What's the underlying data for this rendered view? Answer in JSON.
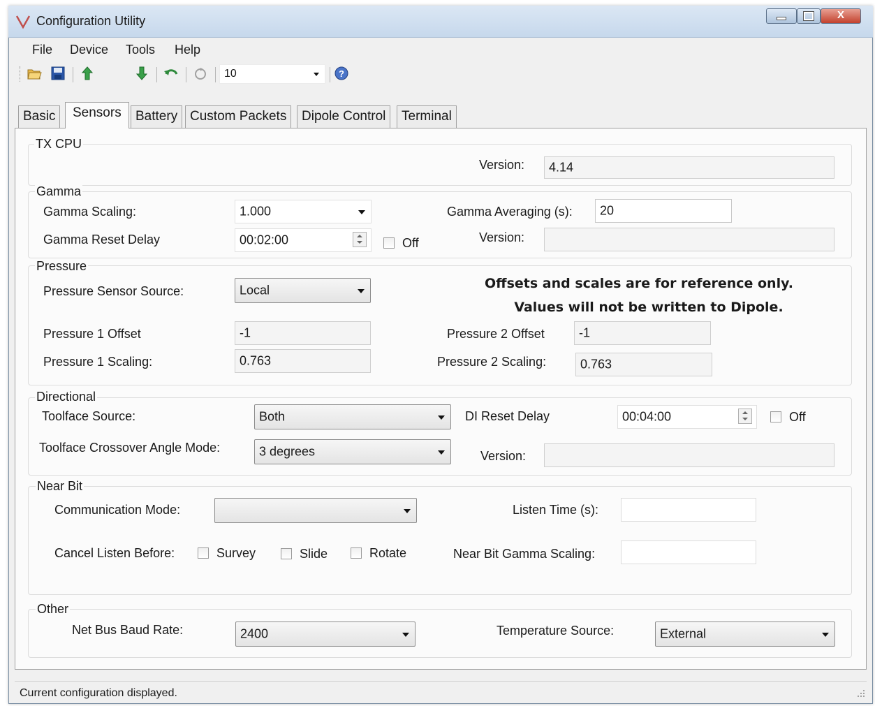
{
  "window": {
    "title": "Configuration Utility"
  },
  "menu": [
    "File",
    "Device",
    "Tools",
    "Help"
  ],
  "toolbar": {
    "combo_value": "10",
    "icons": [
      "open-folder-icon",
      "save-icon",
      "upload-icon",
      "download-icon",
      "undo-icon",
      "refresh-icon",
      "help-icon"
    ]
  },
  "tabs": [
    "Basic",
    "Sensors",
    "Battery",
    "Custom Packets",
    "Dipole Control",
    "Terminal"
  ],
  "active_tab": "Sensors",
  "tx_cpu": {
    "group_label": "TX CPU",
    "version_label": "Version:",
    "version_value": "4.14"
  },
  "gamma": {
    "group_label": "Gamma",
    "scaling_label": "Gamma Scaling:",
    "scaling_value": "1.000",
    "averaging_label": "Gamma Averaging (s):",
    "averaging_value": "20",
    "reset_delay_label": "Gamma Reset Delay",
    "reset_delay_value": "00:02:00",
    "off_label": "Off",
    "version_label": "Version:",
    "version_value": ""
  },
  "pressure": {
    "group_label": "Pressure",
    "source_label": "Pressure Sensor Source:",
    "source_value": "Local",
    "notice_line1": "Offsets and scales are for reference only.",
    "notice_line2": "Values will not be written to Dipole.",
    "p1_offset_label": "Pressure 1 Offset",
    "p1_offset_value": "-1",
    "p2_offset_label": "Pressure 2 Offset",
    "p2_offset_value": "-1",
    "p1_scaling_label": "Pressure 1 Scaling:",
    "p1_scaling_value": "0.763",
    "p2_scaling_label": "Pressure 2 Scaling:",
    "p2_scaling_value": "0.763"
  },
  "directional": {
    "group_label": "Directional",
    "toolface_source_label": "Toolface Source:",
    "toolface_source_value": "Both",
    "di_reset_label": "DI Reset Delay",
    "di_reset_value": "00:04:00",
    "off_label": "Off",
    "crossover_label": "Toolface Crossover Angle Mode:",
    "crossover_value": "3 degrees",
    "version_label": "Version:",
    "version_value": ""
  },
  "near_bit": {
    "group_label": "Near Bit",
    "comm_mode_label": "Communication Mode:",
    "comm_mode_value": "",
    "listen_time_label": "Listen Time (s):",
    "listen_time_value": "",
    "cancel_label": "Cancel Listen Before:",
    "survey_label": "Survey",
    "slide_label": "Slide",
    "rotate_label": "Rotate",
    "gamma_scaling_label": "Near Bit Gamma Scaling:",
    "gamma_scaling_value": ""
  },
  "other": {
    "group_label": "Other",
    "baud_label": "Net Bus Baud Rate:",
    "baud_value": "2400",
    "temp_source_label": "Temperature Source:",
    "temp_source_value": "External"
  },
  "status": {
    "text": "Current configuration displayed."
  }
}
